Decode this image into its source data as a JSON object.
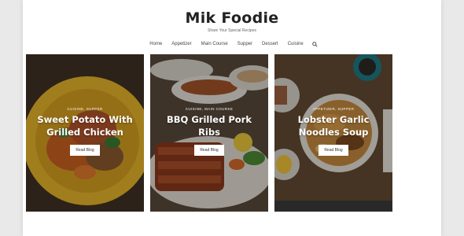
{
  "site": {
    "title": "Mik Foodie",
    "tagline": "Share Your Special Recipes"
  },
  "nav": {
    "items": [
      "Home",
      "Appetizer",
      "Main Course",
      "Supper",
      "Dessert",
      "Cuisine"
    ],
    "search_icon": "search-icon"
  },
  "cards": [
    {
      "category": "CUISINE, SUPPER",
      "title_line1": "Sweet Potato With",
      "title_line2": "Grilled Chicken",
      "button": "Read Blog"
    },
    {
      "category": "CUISINE, MAIN COURSE",
      "title_line1": "BBQ Grilled Pork",
      "title_line2": "Ribs",
      "button": "Read Blog"
    },
    {
      "category": "APPETIZER, SUPPER",
      "title_line1": "Lobster Garlic",
      "title_line2": "Noodles Soup",
      "button": "Read Blog"
    }
  ],
  "colors": {
    "page_bg": "#ffffff",
    "outer_bg": "#e9e9e9",
    "text_dark": "#222222"
  }
}
